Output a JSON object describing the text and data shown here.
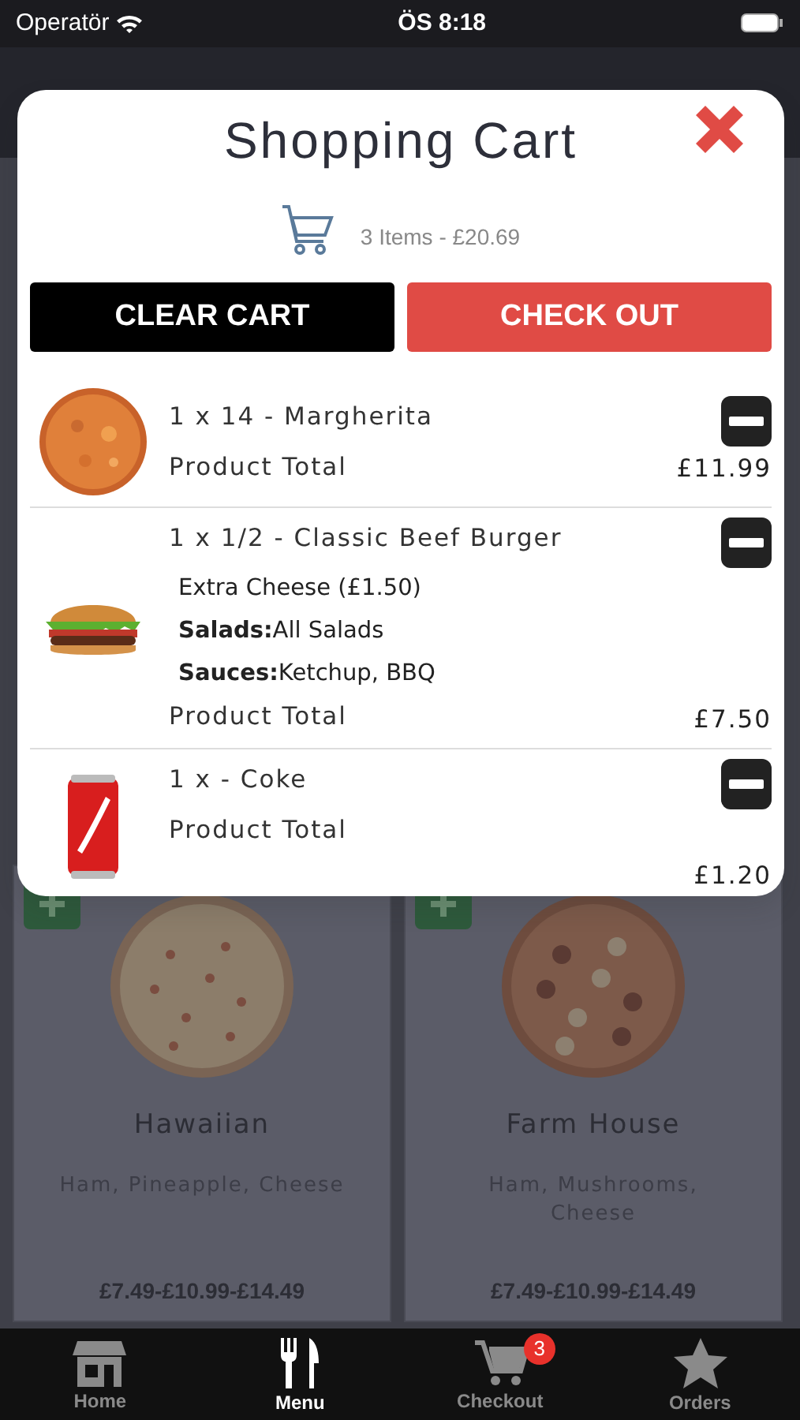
{
  "status_bar": {
    "carrier": "Operatör",
    "time": "ÖS 8:18"
  },
  "cart": {
    "title": "Shopping Cart",
    "summary": "3 Items - £20.69",
    "buttons": [
      {
        "label": "CLEAR CART",
        "kind": "clear"
      },
      {
        "label": "CHECK OUT",
        "kind": "checkout"
      }
    ],
    "items": [
      {
        "kind": "pizza",
        "name": "1 x 14 - Margherita",
        "total_label": "Product Total",
        "total": "£11.99"
      },
      {
        "kind": "burger",
        "name": "1 x 1/2 - Classic Beef Burger",
        "options": [
          "Extra Cheese (£1.50)",
          "**Salads:**All Salads",
          "**Sauces:**Ketchup, BBQ"
        ],
        "total_label": "Product Total",
        "total": "£7.50"
      },
      {
        "kind": "can",
        "name": "1 x - Coke",
        "total_label": "Product Total",
        "total": "£1.20"
      }
    ]
  },
  "menu": [
    {
      "name": "Hawaiian",
      "description": "Ham, Pineapple, Cheese",
      "price": "£7.49-£10.99-£14.49"
    },
    {
      "name": "Farm House",
      "description": "Ham, Mushrooms, Cheese",
      "price": "£7.49-£10.99-£14.49"
    }
  ],
  "tabs": [
    {
      "kind": "store",
      "label": "Home",
      "selected": false
    },
    {
      "kind": "cutlery",
      "label": "Menu",
      "selected": true
    },
    {
      "kind": "cart",
      "label": "Checkout",
      "selected": false,
      "badge": "3"
    },
    {
      "kind": "star",
      "label": "Orders",
      "selected": false
    }
  ]
}
